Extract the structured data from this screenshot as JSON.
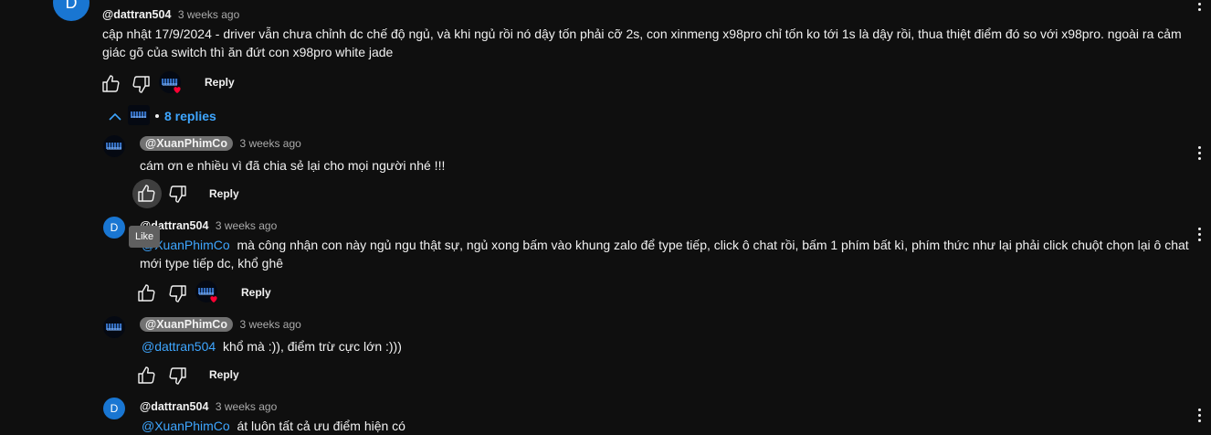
{
  "comments": {
    "top": {
      "avatar_letter": "D",
      "handle": "@dattran504",
      "time": "3 weeks ago",
      "text": "cập nhật 17/9/2024 - driver vẫn chưa chỉnh dc chế độ ngủ, và khi ngủ rồi nó dậy tốn phải cỡ 2s, con xinmeng x98pro chỉ tốn ko tới 1s là dậy rồi, thua thiệt điểm đó so với x98pro. ngoài ra cảm giác gõ của switch thì ăn đứt con x98pro white jade",
      "reply_label": "Reply"
    },
    "replies_toggle": {
      "label": "8 replies",
      "icon": "chevron-up-icon"
    },
    "replies": [
      {
        "avatar": "xuanphimco-avatar",
        "handle": "@XuanPhimCo",
        "time": "3 weeks ago",
        "text": "cám ơn e nhiều vì đã chia sẻ lại cho mọi người nhé !!!",
        "reply_label": "Reply"
      },
      {
        "avatar_letter": "D",
        "handle": "@dattran504",
        "time": "3 weeks ago",
        "mention": "@XuanPhimCo",
        "text": "mà công nhận con này ngủ ngu thật sự, ngủ xong bấm vào khung zalo để type tiếp, click ô chat rồi, bấm 1 phím bất kì, phím thức như lại phải click chuột chọn lại ô chat mới type tiếp dc, khổ ghê",
        "reply_label": "Reply"
      },
      {
        "avatar": "xuanphimco-avatar",
        "handle": "@XuanPhimCo",
        "time": "3 weeks ago",
        "mention": "@dattran504",
        "text": "khổ mà :)), điểm trừ cực lớn :)))",
        "reply_label": "Reply"
      },
      {
        "avatar_letter": "D",
        "handle": "@dattran504",
        "time": "3 weeks ago",
        "mention": "@XuanPhimCo",
        "text": "át luôn tất cả ưu điểm hiện có"
      }
    ]
  },
  "tooltip": {
    "like": "Like"
  },
  "colors": {
    "background": "#0f0f0f",
    "mention": "#3ea6ff",
    "avatar_d": "#1976d2",
    "heart": "#ff0033",
    "pill": "#717171"
  }
}
